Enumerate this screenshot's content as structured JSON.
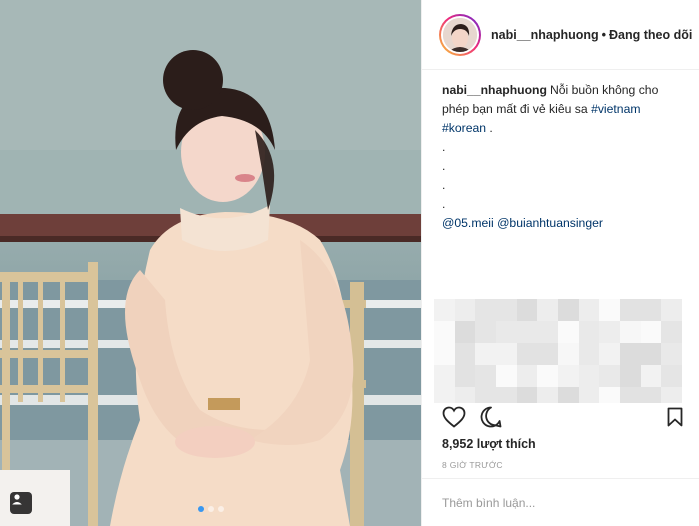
{
  "post": {
    "username": "nabi__nhaphuong",
    "separator": "•",
    "follow_status": "Đang theo dõi",
    "caption": {
      "text": "Nỗi buồn không cho phép bạn mất đi vẻ kiêu sa",
      "hashtag_1": "#vietnam",
      "hashtag_2": "#korean",
      "trailing": " .",
      "dots": [
        ".",
        ".",
        ".",
        "."
      ],
      "mention_1": "@05.meii",
      "mention_2": "@buianhtuansinger"
    },
    "likes": "8,952 lượt thích",
    "time": "8 GIỜ TRƯỚC",
    "comment_placeholder": "Thêm bình luận..."
  },
  "icons": {
    "like": "heart-outline-icon",
    "comment": "speech-bubble-icon",
    "save": "bookmark-icon",
    "profile_tag": "person-tag-icon"
  },
  "colors": {
    "link": "#003569",
    "story_ring_start": "#f9ce34",
    "story_ring_end": "#6228d7",
    "carousel_active": "#3897f0"
  }
}
